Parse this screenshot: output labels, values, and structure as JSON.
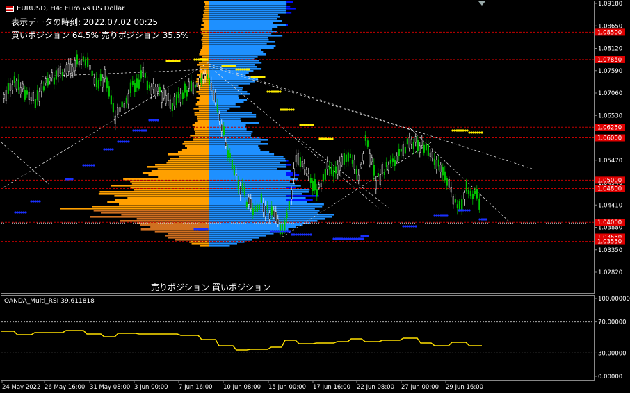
{
  "header": {
    "symbol": "EURUSD, H4:  Euro vs US Dollar",
    "display_time": "表示データの時刻: 2022.07.02 00:25",
    "positions": "買いポジション 64.5% 売りポジション 35.5%"
  },
  "labels": {
    "sell": "売りポジション",
    "buy": "買いポジション"
  },
  "rsi": {
    "label": "OANDA_Multi_RSI 39.611818",
    "levels": [
      "100.00000",
      "70.00000",
      "30.00000",
      "0.00000"
    ]
  },
  "price_axis": [
    "1.09180",
    "1.08650",
    "1.08120",
    "1.07590",
    "1.07060",
    "1.06530",
    "1.06000",
    "1.05470",
    "1.04940",
    "1.04410",
    "1.03880",
    "1.03350",
    "1.02820"
  ],
  "price_tags": [
    "1.08500",
    "1.07850",
    "1.06250",
    "1.06000",
    "1.05000",
    "1.04800",
    "1.04000",
    "1.03650",
    "1.03550"
  ],
  "time_axis": [
    "24 May 2022",
    "26 May 16:00",
    "31 May 08:00",
    "3 Jun 00:00",
    "7 Jun 16:00",
    "10 Jun 08:00",
    "15 Jun 00:00",
    "17 Jun 16:00",
    "22 Jun 08:00",
    "27 Jun 00:00",
    "29 Jun 16:00"
  ],
  "colors": {
    "bull": "#00c400",
    "sell_profile": "#ffa000",
    "buy_profile": "#1e90ff",
    "buy_profile_dark": "#0010ff",
    "tag_bg": "#e00000",
    "dots_yellow": "#ffee00",
    "dots_blue": "#1a30ff",
    "rsi_line": "#ffe000",
    "grid_red": "#c00000"
  }
}
